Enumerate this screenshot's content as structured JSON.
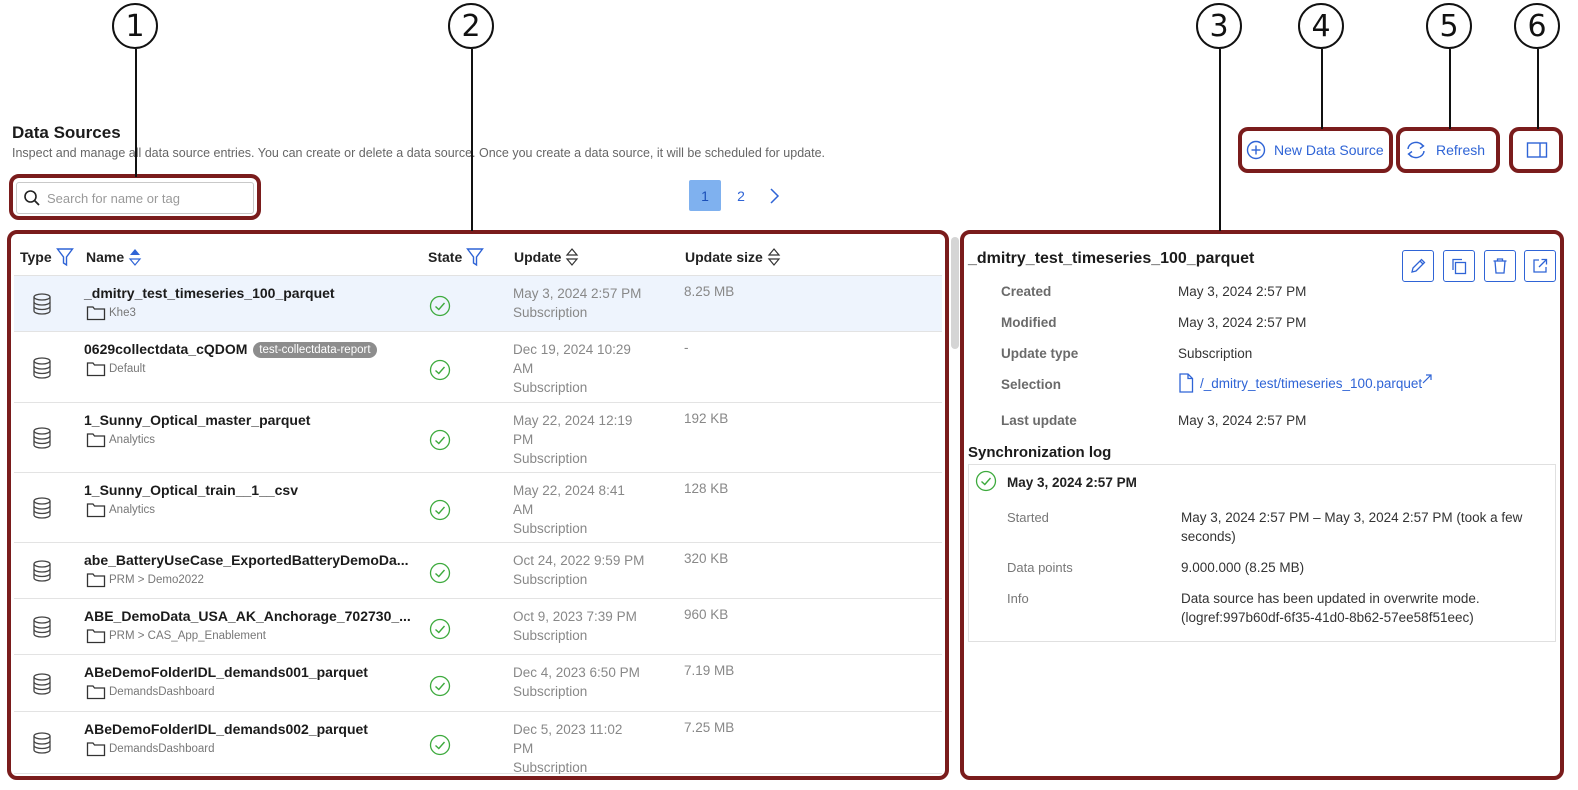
{
  "callouts": [
    "1",
    "2",
    "3",
    "4",
    "5",
    "6"
  ],
  "header": {
    "title": "Data Sources",
    "subtitle": "Inspect and manage all data source entries. You can create or delete a data source. Once you create a data source, it will be scheduled for update."
  },
  "search": {
    "placeholder": "Search for name or tag",
    "value": ""
  },
  "pagination": {
    "pages": [
      "1",
      "2"
    ],
    "current": "1"
  },
  "toolbar": {
    "new_label": "New Data Source",
    "refresh_label": "Refresh"
  },
  "table": {
    "columns": {
      "type": "Type",
      "name": "Name",
      "state": "State",
      "update": "Update",
      "size": "Update size"
    },
    "rows": [
      {
        "name": "_dmitry_test_timeseries_100_parquet",
        "tag": "",
        "folder": "Khe3",
        "update_lines": [
          "May 3, 2024 2:57 PM",
          "Subscription"
        ],
        "size": "8.25 MB"
      },
      {
        "name": "0629collectdata_cQDOM",
        "tag": "test-collectdata-report",
        "folder": "Default",
        "update_lines": [
          "Dec 19, 2024 10:29",
          "AM",
          "Subscription"
        ],
        "size": "-"
      },
      {
        "name": "1_Sunny_Optical_master_parquet",
        "tag": "",
        "folder": "Analytics",
        "update_lines": [
          "May 22, 2024 12:19",
          "PM",
          "Subscription"
        ],
        "size": "192 KB"
      },
      {
        "name": "1_Sunny_Optical_train__1__csv",
        "tag": "",
        "folder": "Analytics",
        "update_lines": [
          "May 22, 2024 8:41",
          "AM",
          "Subscription"
        ],
        "size": "128 KB"
      },
      {
        "name": "abe_BatteryUseCase_ExportedBatteryDemoDa...",
        "tag": "",
        "folder": "PRM > Demo2022",
        "update_lines": [
          "Oct 24, 2022 9:59 PM",
          "Subscription"
        ],
        "size": "320 KB"
      },
      {
        "name": "ABE_DemoData_USA_AK_Anchorage_702730_...",
        "tag": "",
        "folder": "PRM > CAS_App_Enablement",
        "update_lines": [
          "Oct 9, 2023 7:39 PM",
          "Subscription"
        ],
        "size": "960 KB"
      },
      {
        "name": "ABeDemoFolderIDL_demands001_parquet",
        "tag": "",
        "folder": "DemandsDashboard",
        "update_lines": [
          "Dec 4, 2023 6:50 PM",
          "Subscription"
        ],
        "size": "7.19 MB"
      },
      {
        "name": "ABeDemoFolderIDL_demands002_parquet",
        "tag": "",
        "folder": "DemandsDashboard",
        "update_lines": [
          "Dec 5, 2023 11:02",
          "PM",
          "Subscription"
        ],
        "size": "7.25 MB"
      }
    ]
  },
  "detail": {
    "title": "_dmitry_test_timeseries_100_parquet",
    "meta": [
      {
        "label": "Created",
        "value": "May 3, 2024 2:57 PM"
      },
      {
        "label": "Modified",
        "value": "May 3, 2024 2:57 PM"
      },
      {
        "label": "Update type",
        "value": "Subscription"
      },
      {
        "label": "Selection",
        "value": "/_dmitry_test/timeseries_100.parquet"
      },
      {
        "label": "Last update",
        "value": "May 3, 2024 2:57 PM"
      }
    ],
    "sync_title": "Synchronization log",
    "log": {
      "date": "May 3, 2024 2:57 PM",
      "started_label": "Started",
      "started_value": "May 3, 2024 2:57 PM – May 3, 2024 2:57 PM (took a few seconds)",
      "points_label": "Data points",
      "points_value": "9.000.000 (8.25 MB)",
      "info_label": "Info",
      "info_value": "Data source has been updated in overwrite mode. (logref:997b60df-6f35-41d0-8b62-57ee58f51eec)"
    }
  },
  "colors": {
    "accent": "#2f64d6",
    "success": "#3daa3d",
    "callout_box": "#7a1c1c"
  }
}
